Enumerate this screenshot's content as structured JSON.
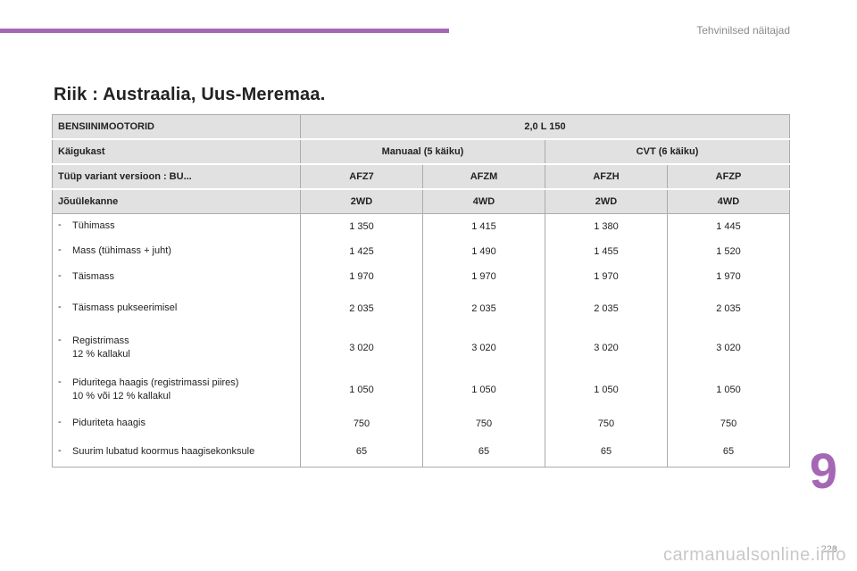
{
  "header": {
    "section_label": "Tehvinilsed näitajad"
  },
  "title": "Riik : Austraalia, Uus-Meremaa.",
  "table": {
    "engine_label": "BENSIINIMOOTORID",
    "engine_value": "2,0 L 150",
    "gearbox_label": "Käigukast",
    "gearbox_manual": "Manuaal (5 käiku)",
    "gearbox_cvt": "CVT (6 käiku)",
    "variant_label": "Tüüp variant versioon : BU...",
    "variants": [
      "AFZ7",
      "AFZM",
      "AFZH",
      "AFZP"
    ],
    "drive_label": "Jõuülekanne",
    "drives": [
      "2WD",
      "4WD",
      "2WD",
      "4WD"
    ],
    "rows": [
      {
        "bullet": "-",
        "lines": [
          "Tühimass"
        ],
        "values": [
          "1 350",
          "1 415",
          "1 380",
          "1 445"
        ]
      },
      {
        "bullet": "-",
        "lines": [
          "Mass (tühimass + juht)"
        ],
        "values": [
          "1 425",
          "1 490",
          "1 455",
          "1 520"
        ]
      },
      {
        "bullet": "-",
        "lines": [
          "Täismass"
        ],
        "values": [
          "1 970",
          "1 970",
          "1 970",
          "1 970"
        ]
      },
      {
        "bullet": "-",
        "lines": [
          "Täismass pukseerimisel"
        ],
        "values": [
          "2 035",
          "2 035",
          "2 035",
          "2 035"
        ]
      },
      {
        "bullet": "-",
        "lines": [
          "Registrimass",
          "12 % kallakul"
        ],
        "values": [
          "3 020",
          "3 020",
          "3 020",
          "3 020"
        ]
      },
      {
        "bullet": "-",
        "lines": [
          "Piduritega haagis (registrimassi piires)",
          "10 % või 12 % kallakul"
        ],
        "values": [
          "1 050",
          "1 050",
          "1 050",
          "1 050"
        ]
      },
      {
        "bullet": "-",
        "lines": [
          "Piduriteta haagis"
        ],
        "values": [
          "750",
          "750",
          "750",
          "750"
        ]
      },
      {
        "bullet": "-",
        "lines": [
          "Suurim lubatud koormus haagisekonksule"
        ],
        "values": [
          "65",
          "65",
          "65",
          "65"
        ]
      }
    ]
  },
  "footer": {
    "chapter": "9",
    "page": "223",
    "watermark": "carmanualsonline.info"
  },
  "colors": {
    "accent": "#a567b5",
    "header_bg": "#e1e1e1",
    "border": "#ababab"
  }
}
